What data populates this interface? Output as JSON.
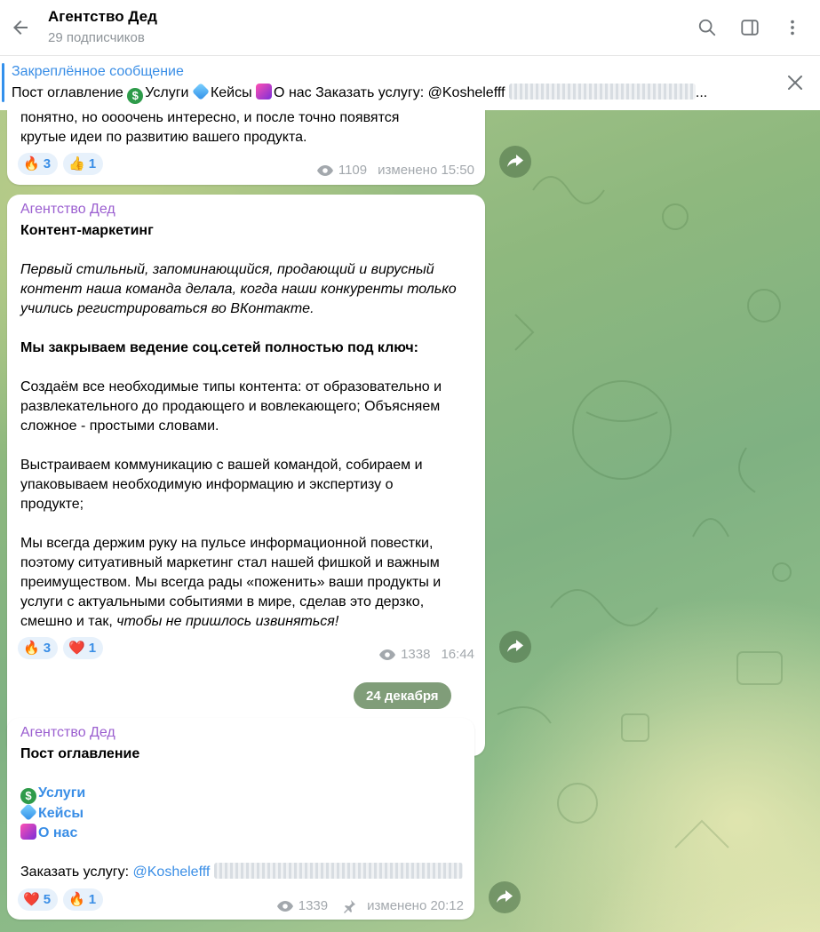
{
  "header": {
    "title": "Агентство Дед",
    "subtitle": "29 подписчиков"
  },
  "pinned": {
    "title": "Закреплённое сообщение",
    "text_prefix": "Пост оглавление",
    "text_services": "Услуги",
    "text_cases": "Кейсы",
    "text_about": "О нас",
    "text_order": "Заказать услугу: @Koshelefff",
    "text_ellipsis": "..."
  },
  "post1": {
    "line1": "понятно, но оооочень интересно, и после точно появятся",
    "line2": "крутые идеи по развитию вашего продукта.",
    "reactions": [
      {
        "emoji": "🔥",
        "count": "3"
      },
      {
        "emoji": "👍",
        "count": "1"
      }
    ],
    "views": "1109",
    "edited": "изменено 15:50"
  },
  "post2": {
    "sender": "Агентство Дед",
    "heading": "Контент-маркетинг",
    "intro_l1": "Первый стильный, запоминающийся, продающий и вирусный",
    "intro_l2": "контент наша команда делала, когда наши конкуренты только",
    "intro_l3": "учились регистрироваться во ВКонтакте.",
    "bold": "Мы закрываем ведение соц.сетей полностью под ключ:",
    "p1_l1": "Создаём все необходимые типы контента: от образовательно и",
    "p1_l2": "развлекательного до продающего и вовлекающего; Объясняем",
    "p1_l3": "сложное - простыми словами.",
    "p2_l1": "Выстраиваем коммуникацию с вашей командой, собираем и",
    "p2_l2": "упаковываем необходимую информацию и экспертизу о",
    "p2_l3": "продукте;",
    "p3_l1": "Мы всегда держим руку на пульсе информационной повестки,",
    "p3_l2": "поэтому ситуативный маркетинг стал нашей фишкой и важным",
    "p3_l3": "преимуществом. Мы всегда рады «поженить» ваши продукты и",
    "p3_l4": "услуги с актуальными событиями в мире, сделав это дерзко,",
    "p3_l5a": "смешно и так,",
    "p3_l5b": "чтобы не пришлось извиняться!",
    "reactions": [
      {
        "emoji": "🔥",
        "count": "3"
      },
      {
        "emoji": "❤️",
        "count": "1"
      }
    ],
    "views": "1338",
    "time": "16:44"
  },
  "date_chip": "24 декабря",
  "post3": {
    "sender": "Агентство Дед",
    "heading": "Пост оглавление",
    "link_services": "Услуги",
    "link_cases": "Кейсы",
    "link_about": "О нас",
    "order_label": "Заказать услугу:",
    "order_handle": "@Koshelefff",
    "reactions": [
      {
        "emoji": "❤️",
        "count": "5"
      },
      {
        "emoji": "🔥",
        "count": "1"
      }
    ],
    "views": "1339",
    "edited": "изменено 20:12"
  },
  "colors": {
    "accent": "#3a8ee6",
    "sender": "#9b5fd0",
    "meta": "#a3a8ad"
  }
}
